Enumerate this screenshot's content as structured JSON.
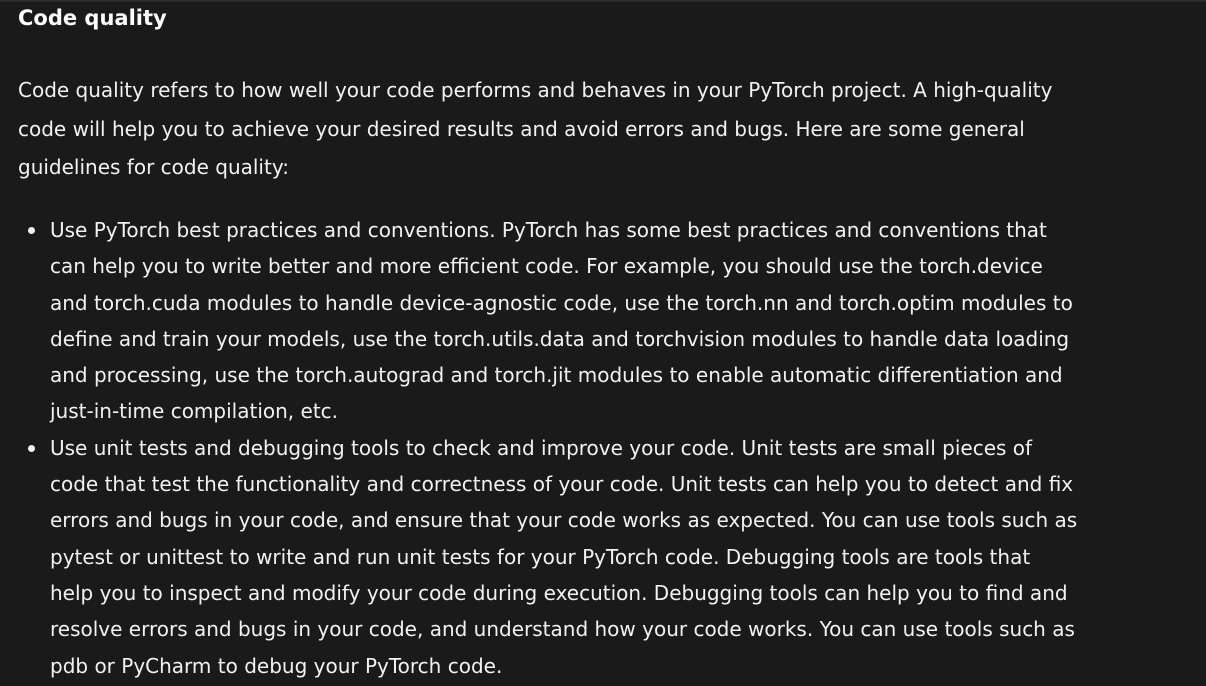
{
  "section": {
    "heading": "Code quality",
    "intro": "Code quality refers to how well your code performs and behaves in your PyTorch project. A high-quality code will help you to achieve your desired results and avoid errors and bugs. Here are some general guidelines for code quality:",
    "guidelines": [
      "Use PyTorch best practices and conventions. PyTorch has some best practices and conventions that can help you to write better and more efficient code. For example, you should use the torch.device and torch.cuda modules to handle device-agnostic code, use the torch.nn and torch.optim modules to define and train your models, use the torch.utils.data and torchvision modules to handle data loading and processing, use the torch.autograd and torch.jit modules to enable automatic differentiation and just-in-time compilation, etc.",
      "Use unit tests and debugging tools to check and improve your code. Unit tests are small pieces of code that test the functionality and correctness of your code. Unit tests can help you to detect and fix errors and bugs in your code, and ensure that your code works as expected. You can use tools such as pytest or unittest to write and run unit tests for your PyTorch code. Debugging tools are tools that help you to inspect and modify your code during execution. Debugging tools can help you to find and resolve errors and bugs in your code, and understand how your code works. You can use tools such as pdb or PyCharm to debug your PyTorch code."
    ]
  },
  "colors": {
    "background": "#1a1a1a",
    "text": "#f2f2f2",
    "heading": "#ffffff"
  }
}
